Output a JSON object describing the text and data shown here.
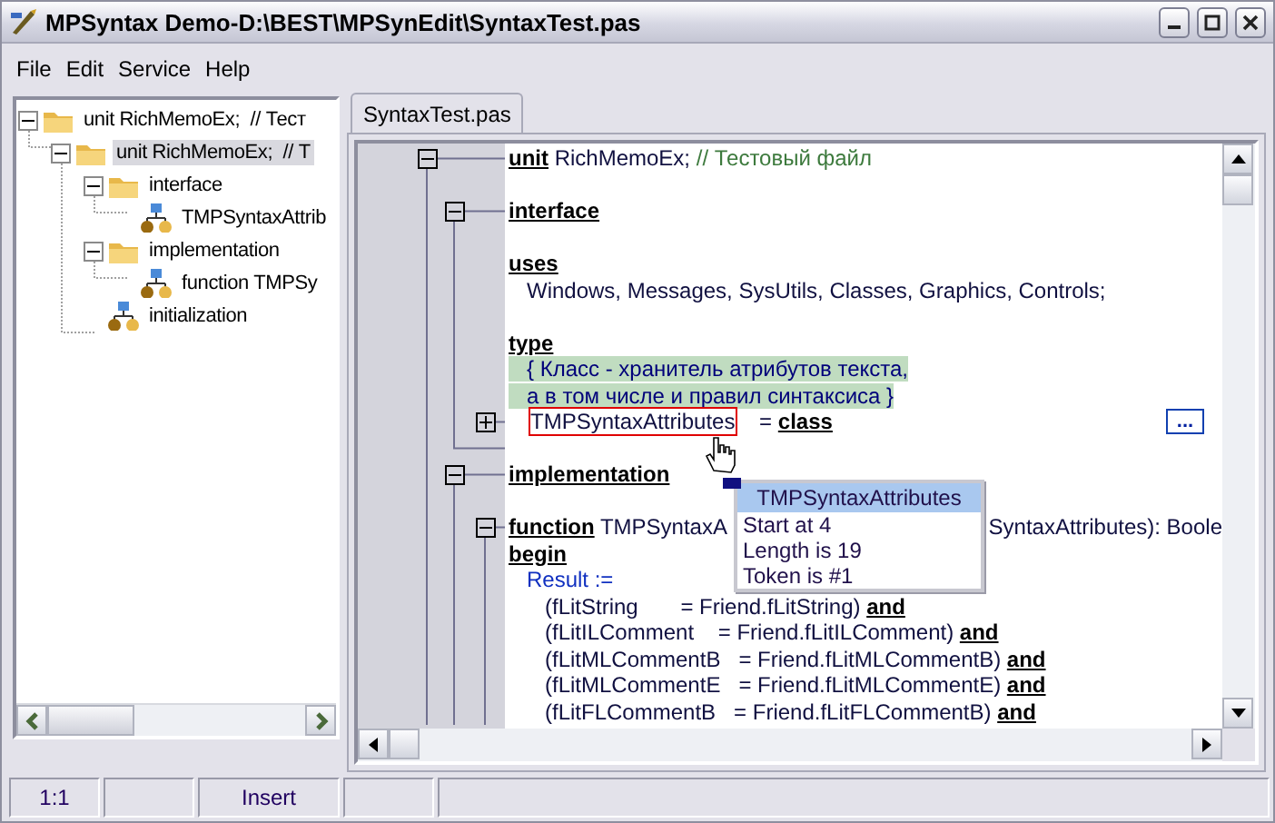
{
  "window": {
    "title": "MPSyntax Demo-D:\\BEST\\MPSynEdit\\SyntaxTest.pas"
  },
  "menu": [
    "File",
    "Edit",
    "Service",
    "Help"
  ],
  "tree": [
    {
      "label": "unit RichMemoEx;  // Тест",
      "kind": "group",
      "expanded": true,
      "selected": false,
      "children": [
        {
          "label": "unit RichMemoEx;  // Т",
          "kind": "group",
          "expanded": true,
          "selected": true,
          "children": [
            {
              "label": "interface",
              "kind": "group",
              "expanded": true,
              "selected": false,
              "children": [
                {
                  "label": "TMPSyntaxAttrib",
                  "kind": "leaf",
                  "selected": false
                }
              ]
            },
            {
              "label": "implementation",
              "kind": "group",
              "expanded": true,
              "selected": false,
              "children": [
                {
                  "label": "function TMPSy",
                  "kind": "leaf",
                  "selected": false
                }
              ]
            },
            {
              "label": "initialization",
              "kind": "leaf",
              "selected": false
            }
          ]
        }
      ]
    }
  ],
  "tabs": [
    {
      "label": "SyntaxTest.pas",
      "selected": true
    }
  ],
  "code": [
    {
      "kind": "unit",
      "folded": false,
      "parts": [
        {
          "kind": "kw",
          "text": "unit"
        },
        {
          "kind": "text",
          "text": " RichMemoEx; "
        },
        {
          "kind": "comment",
          "text": "// Тестовый файл"
        }
      ]
    },
    {
      "kind": "blank"
    },
    {
      "kind": "section",
      "folded": false,
      "parts": [
        {
          "kind": "kw",
          "text": "interface"
        }
      ]
    },
    {
      "kind": "blank"
    },
    {
      "kind": "plain",
      "parts": [
        {
          "kind": "kw",
          "text": "uses"
        }
      ]
    },
    {
      "kind": "plain",
      "parts": [
        {
          "kind": "text",
          "text": "   Windows, Messages, SysUtils, Classes, Graphics, Controls;"
        }
      ]
    },
    {
      "kind": "blank"
    },
    {
      "kind": "plain",
      "parts": [
        {
          "kind": "kw",
          "text": "type"
        }
      ]
    },
    {
      "kind": "plain",
      "parts": [
        {
          "kind": "doc",
          "text": "   { Класс - хранитель атрибутов текста,"
        }
      ]
    },
    {
      "kind": "plain",
      "parts": [
        {
          "kind": "doc",
          "text": "   а в том числе и правил синтаксиса }"
        }
      ]
    },
    {
      "kind": "block",
      "folded": true,
      "indented": true,
      "more": "...",
      "parts": [
        {
          "kind": "text",
          "text": "TMPSyntaxAttributes",
          "boxed": true
        },
        {
          "kind": "text",
          "text": "    = "
        },
        {
          "kind": "kw",
          "text": "class"
        }
      ]
    },
    {
      "kind": "blank"
    },
    {
      "kind": "section",
      "folded": false,
      "parts": [
        {
          "kind": "kw",
          "text": "implementation"
        }
      ]
    },
    {
      "kind": "blank"
    },
    {
      "kind": "block",
      "folded": false,
      "tail": "SyntaxAttributes): Boole",
      "parts": [
        {
          "kind": "kw",
          "text": "function"
        },
        {
          "kind": "text",
          "text": " TMPSyntaxA"
        }
      ]
    },
    {
      "kind": "plain",
      "parts": [
        {
          "kind": "kw",
          "text": "begin"
        }
      ]
    },
    {
      "kind": "plain",
      "parts": [
        {
          "kind": "result",
          "text": "   Result :="
        }
      ]
    },
    {
      "kind": "plain",
      "parts": [
        {
          "kind": "text",
          "text": "      (fLitString       = Friend.fLitString) "
        },
        {
          "kind": "kw",
          "text": "and"
        }
      ]
    },
    {
      "kind": "plain",
      "parts": [
        {
          "kind": "text",
          "text": "      (fLitILComment    = Friend.fLitILComment) "
        },
        {
          "kind": "kw",
          "text": "and"
        }
      ]
    },
    {
      "kind": "plain",
      "parts": [
        {
          "kind": "text",
          "text": "      (fLitMLCommentB   = Friend.fLitMLCommentB) "
        },
        {
          "kind": "kw",
          "text": "and"
        }
      ]
    },
    {
      "kind": "plain",
      "parts": [
        {
          "kind": "text",
          "text": "      (fLitMLCommentE   = Friend.fLitMLCommentE) "
        },
        {
          "kind": "kw",
          "text": "and"
        }
      ]
    },
    {
      "kind": "plain",
      "parts": [
        {
          "kind": "text",
          "text": "      (fLitFLCommentB   = Friend.fLitFLCommentB) "
        },
        {
          "kind": "kw",
          "text": "and"
        }
      ]
    }
  ],
  "popup": {
    "title": "TMPSyntaxAttributes",
    "lines": [
      "Start at 4",
      "Length is 19",
      "Token is #1"
    ]
  },
  "status_bar": {
    "position": "1:1",
    "mode": "Insert"
  }
}
